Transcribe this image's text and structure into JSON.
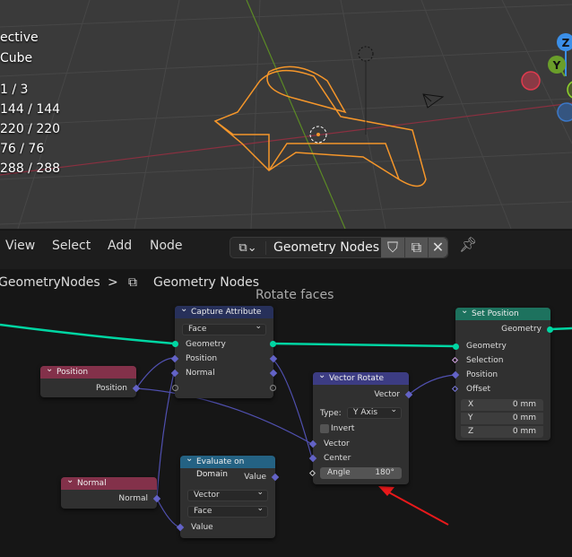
{
  "viewport": {
    "stats": [
      "ective",
      "Cube",
      "1 / 3",
      "144 / 144",
      "220 / 220",
      "76 / 76",
      "288 / 288"
    ],
    "gizmo": {
      "z": "Z",
      "y": "Y"
    }
  },
  "header": {
    "menu": [
      "View",
      "Select",
      "Add",
      "Node"
    ],
    "node_group": "Geometry Nodes",
    "icons": [
      "node-tree-icon",
      "shield-icon",
      "duplicate-icon",
      "close-icon",
      "pin-icon"
    ]
  },
  "breadcrumb": {
    "parent": "GeometryNodes",
    "separator": ">",
    "current": "Geometry Nodes"
  },
  "frame_label": "Rotate faces",
  "nodes": {
    "capture": {
      "title": "Capture Attribute",
      "domain": "Face",
      "rows": [
        "Geometry",
        "Position",
        "Normal"
      ]
    },
    "position": {
      "title": "Position",
      "out": "Position"
    },
    "normal": {
      "title": "Normal",
      "out": "Normal"
    },
    "evaluate": {
      "title": "Evaluate on Domain",
      "out": "Value",
      "type": "Vector",
      "domain": "Face",
      "in": "Value"
    },
    "rotate": {
      "title": "Vector Rotate",
      "out": "Vector",
      "type_label": "Type:",
      "type": "Y Axis",
      "invert": "Invert",
      "vector": "Vector",
      "center": "Center",
      "angle_label": "Angle",
      "angle": "180°"
    },
    "setpos": {
      "title": "Set Position",
      "out": "Geometry",
      "geometry": "Geometry",
      "selection": "Selection",
      "position": "Position",
      "offset": "Offset",
      "x_label": "X",
      "x": "0 mm",
      "y_label": "Y",
      "y": "0 mm",
      "z_label": "Z",
      "z": "0 mm"
    }
  },
  "colors": {
    "geometry_socket": "#00d6a3",
    "vector_socket": "#6363c7",
    "input_header": "#83314a",
    "attribute_header": "#27305a",
    "vector_header": "#3c3c83",
    "geometry_header": "#1d725e",
    "field_header": "#246283",
    "selection": "#f5962a",
    "annotation_arrow": "#e8191b"
  }
}
